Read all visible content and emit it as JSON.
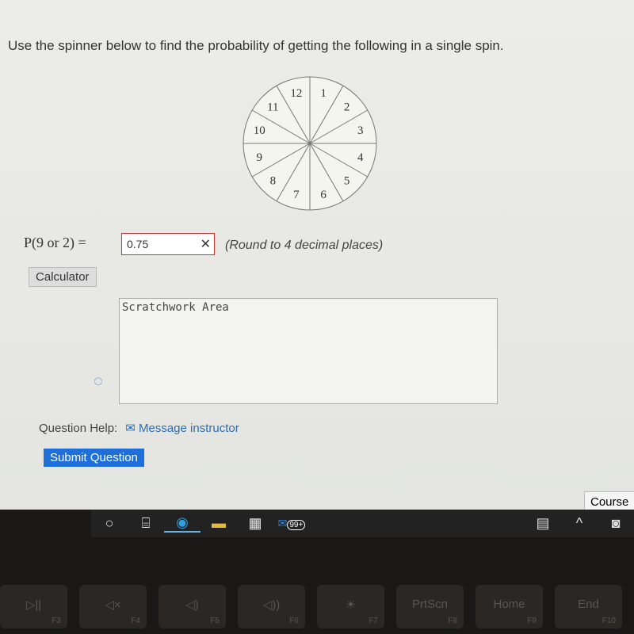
{
  "question": "Use the spinner below to find the probability of getting the following in a single spin.",
  "spinner": {
    "labels": [
      "12",
      "1",
      "2",
      "3",
      "4",
      "5",
      "6",
      "7",
      "8",
      "9",
      "10",
      "11"
    ]
  },
  "answer": {
    "expression": "P(9  or  2) =",
    "value": "0.75",
    "status": "incorrect",
    "hint": "(Round to 4 decimal places)"
  },
  "calculator_label": "Calculator",
  "scratch_placeholder": "Scratchwork Area",
  "help": {
    "label": "Question Help:",
    "message": "Message instructor"
  },
  "submit_label": "Submit Question",
  "course_label": "Course",
  "taskbar": {
    "mail_badge": "99+"
  },
  "keys": [
    {
      "main": "▷||",
      "f": "F3"
    },
    {
      "main": "◁×",
      "f": "F4"
    },
    {
      "main": "◁)",
      "f": "F5"
    },
    {
      "main": "◁))",
      "f": "F6"
    },
    {
      "main": "☀",
      "f": "F7"
    },
    {
      "main": "PrtScn",
      "f": "F8"
    },
    {
      "main": "Home",
      "f": "F9"
    },
    {
      "main": "End",
      "f": "F10"
    }
  ]
}
